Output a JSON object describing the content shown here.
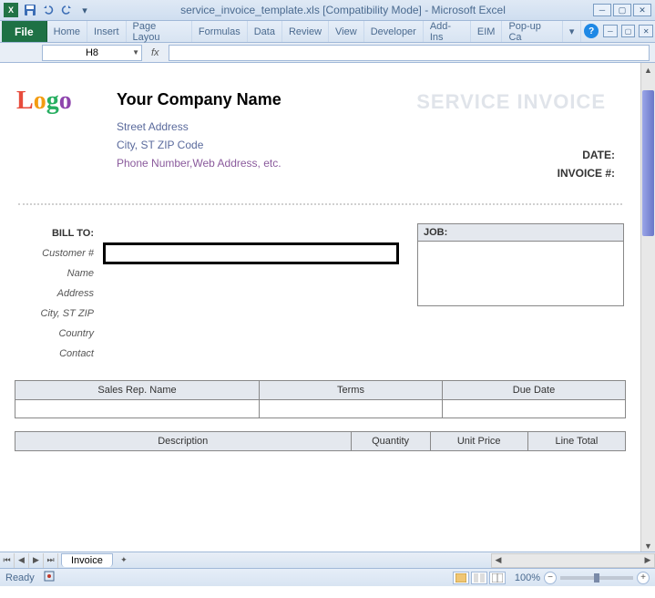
{
  "title": "service_invoice_template.xls  [Compatibility Mode]  -  Microsoft Excel",
  "ribbon": {
    "file": "File",
    "tabs": [
      "Home",
      "Insert",
      "Page Layou",
      "Formulas",
      "Data",
      "Review",
      "View",
      "Developer",
      "Add-Ins",
      "EIM",
      "Pop-up Ca"
    ]
  },
  "name_box": "H8",
  "fx": "fx",
  "invoice": {
    "logo_text": "Logo",
    "company_name": "Your Company Name",
    "street": "Street Address",
    "city": "City, ST  ZIP Code",
    "contact": "Phone Number,Web Address, etc.",
    "service_title": "SERVICE INVOICE",
    "date_label": "DATE:",
    "invoice_no_label": "INVOICE #:",
    "bill_to": "BILL TO:",
    "job": "JOB:",
    "labels": {
      "customer": "Customer #",
      "name": "Name",
      "address": "Address",
      "cityzip": "City, ST ZIP",
      "country": "Country",
      "contact": "Contact"
    },
    "sales_headers": [
      "Sales Rep. Name",
      "Terms",
      "Due Date"
    ],
    "desc_headers": [
      "Description",
      "Quantity",
      "Unit Price",
      "Line Total"
    ]
  },
  "sheet_tab": "Invoice",
  "status": {
    "ready": "Ready",
    "zoom": "100%"
  }
}
